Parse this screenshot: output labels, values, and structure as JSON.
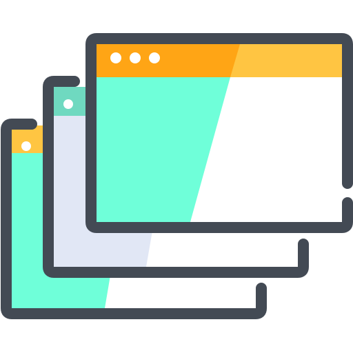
{
  "icon": {
    "name": "stacked-browser-windows-icon",
    "colors": {
      "outline": "#434a54",
      "titlebar_dark": "#ffa515",
      "titlebar_light": "#ffc542",
      "panel_mint": "#6fffd9",
      "panel_lavender": "#e1e7f5",
      "background": "#ffffff",
      "dot": "#ffffff"
    },
    "windows": [
      {
        "name": "back-window",
        "titlebar": "orange",
        "dots": 1
      },
      {
        "name": "middle-window",
        "titlebar": "mint",
        "dots": 1
      },
      {
        "name": "front-window",
        "titlebar": "orange",
        "dots": 3
      }
    ]
  }
}
